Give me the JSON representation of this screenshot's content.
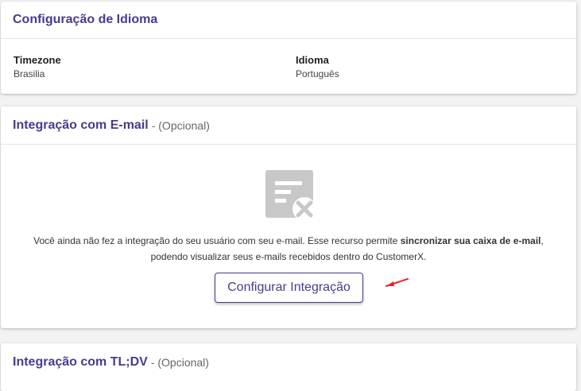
{
  "language_card": {
    "title": "Configuração de Idioma",
    "timezone_label": "Timezone",
    "timezone_value": "Brasilia",
    "language_label": "Idioma",
    "language_value": "Português"
  },
  "email_card": {
    "title": "Integração com E-mail",
    "optional": "- (Opcional)",
    "message_part1": "Você ainda não fez a integração do seu usuário com seu e-mail. Esse recurso permite ",
    "message_bold": "sincronizar sua caixa de e-mail",
    "message_part2": ", podendo visualizar seus e-mails recebidos dentro do CustomerX.",
    "button_label": "Configurar Integração",
    "icon": "document-x-icon",
    "annotation_icon": "red-arrow-icon"
  },
  "tldv_card": {
    "title": "Integração com TL;DV",
    "optional": "- (Opcional)"
  },
  "colors": {
    "accent": "#4b3a8c",
    "background": "#f2f2f2",
    "annotation": "#e8262b",
    "icon_gray": "#c8c8c8"
  }
}
